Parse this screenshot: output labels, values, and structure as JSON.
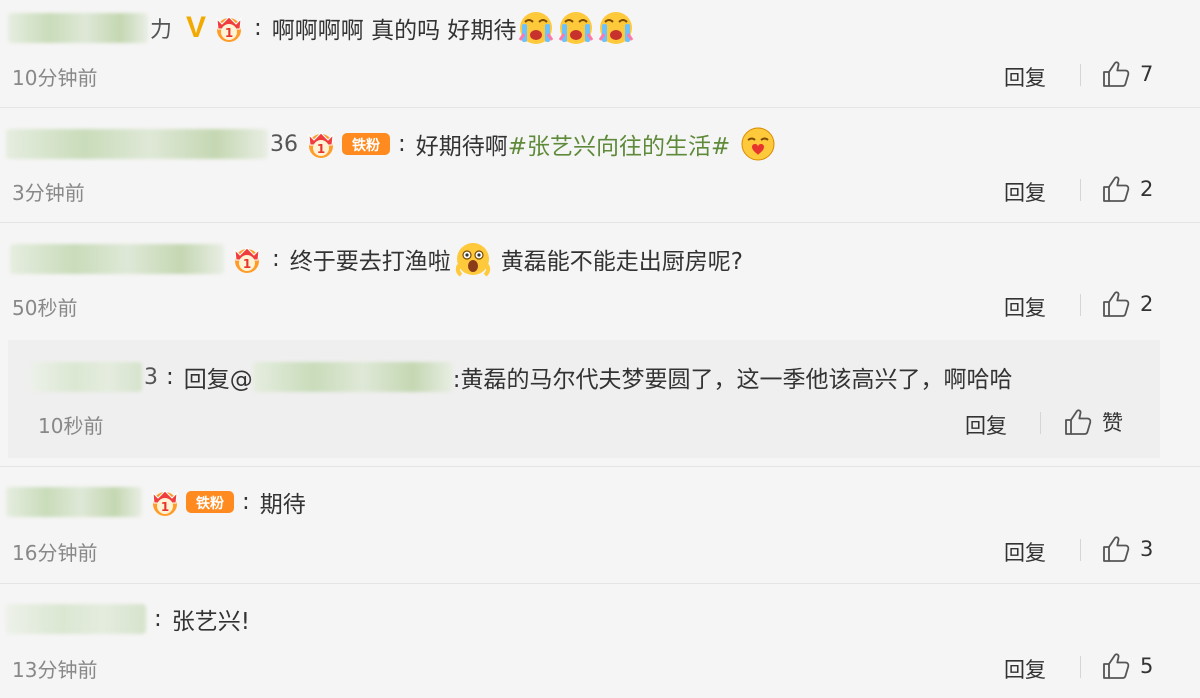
{
  "comments": [
    {
      "name_frag": "力",
      "text": "啊啊啊啊 真的吗 好期待",
      "time": "10分钟前",
      "reply": "回复",
      "likes": "7"
    },
    {
      "name_frag": "36",
      "text": "好期待啊",
      "topic": "#张艺兴向往的生活#",
      "time": "3分钟前",
      "reply": "回复",
      "likes": "2"
    },
    {
      "text": "终于要去打渔啦",
      "text2": "黄磊能不能走出厨房呢?",
      "time": "50秒前",
      "reply": "回复",
      "likes": "2"
    },
    {
      "text": "期待",
      "time": "16分钟前",
      "reply": "回复",
      "likes": "3"
    },
    {
      "text": "张艺兴!",
      "time": "13分钟前",
      "reply": "回复",
      "likes": "5"
    }
  ],
  "subreply": {
    "name_frag": "3",
    "reply_prefix": "回复@",
    "text": ":黄磊的马尔代夫梦要圆了，这一季他该高兴了，啊哈哈",
    "time": "10秒前",
    "reply": "回复",
    "like_label": "赞"
  },
  "badges": {
    "v": "V",
    "fans": "铁粉"
  },
  "colors": {
    "background": "#f5f5f5",
    "topic": "#5e8a3a",
    "time": "#888888",
    "vip_gold": "#f2a900"
  },
  "icons": [
    "thumbs-up-icon",
    "crown-icon",
    "fans-badge-icon",
    "crying-emoji",
    "heart-kiss-emoji",
    "scared-emoji"
  ]
}
